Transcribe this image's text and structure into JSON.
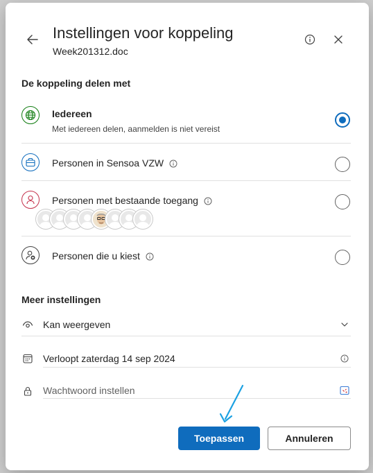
{
  "header": {
    "title": "Instellingen voor koppeling",
    "filename": "Week201312.doc"
  },
  "share_section": {
    "label": "De koppeling delen met",
    "options": [
      {
        "label": "Iedereen",
        "description": "Met iedereen delen, aanmelden is niet vereist",
        "selected": true,
        "icon": "globe-icon"
      },
      {
        "label": "Personen in Sensoa VZW",
        "selected": false,
        "icon": "briefcase-icon"
      },
      {
        "label": "Personen met bestaande toegang",
        "selected": false,
        "icon": "person-icon"
      },
      {
        "label": "Personen die u kiest",
        "selected": false,
        "icon": "person-add-icon"
      }
    ]
  },
  "more_settings": {
    "label": "Meer instellingen",
    "permission": "Kan weergeven",
    "expiry": "Verloopt zaterdag 14 sep 2024",
    "password_placeholder": "Wachtwoord instellen"
  },
  "buttons": {
    "apply": "Toepassen",
    "cancel": "Annuleren"
  },
  "colors": {
    "accent": "#0f6cbd",
    "globe": "#107c10",
    "briefcase": "#0f6cbd",
    "person": "#c4314b",
    "annotation_arrow": "#1ba1e2"
  }
}
